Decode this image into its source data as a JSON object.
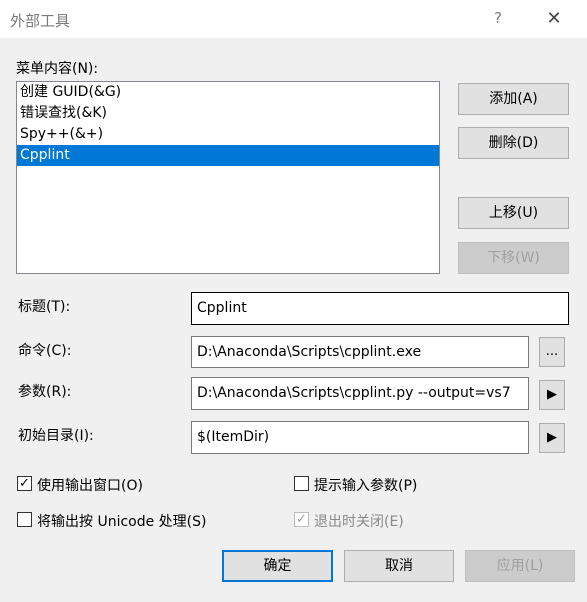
{
  "window": {
    "title": "外部工具",
    "help_symbol": "?",
    "close_symbol": "✕"
  },
  "menu": {
    "label": "菜单内容(N):",
    "items": [
      "创建 GUID(&G)",
      "错误查找(&K)",
      "Spy++(&+)",
      "Cpplint"
    ],
    "selected_index": 3
  },
  "buttons": {
    "add": "添加(A)",
    "delete": "删除(D)",
    "move_up": "上移(U)",
    "move_down": "下移(W)",
    "ok": "确定",
    "cancel": "取消",
    "apply": "应用(L)"
  },
  "fields": {
    "title_label": "标题(T):",
    "title_value": "Cpplint",
    "command_label": "命令(C):",
    "command_value": "D:\\Anaconda\\Scripts\\cpplint.exe",
    "args_label": "参数(R):",
    "args_value": "D:\\Anaconda\\Scripts\\cpplint.py --output=vs7",
    "initdir_label": "初始目录(I):",
    "initdir_value": "$(ItemDir)",
    "browse_symbol": "...",
    "arrow_symbol": "▶"
  },
  "options": {
    "use_output_window": {
      "label": "使用输出窗口(O)",
      "checked": true
    },
    "prompt_args": {
      "label": "提示输入参数(P)",
      "checked": false
    },
    "unicode_output": {
      "label": "将输出按 Unicode 处理(S)",
      "checked": false
    },
    "close_on_exit": {
      "label": "退出时关闭(E)",
      "checked": true,
      "disabled": true
    }
  },
  "colors": {
    "selection": "#0078d7",
    "dialog_bg": "#f0f0f0"
  }
}
